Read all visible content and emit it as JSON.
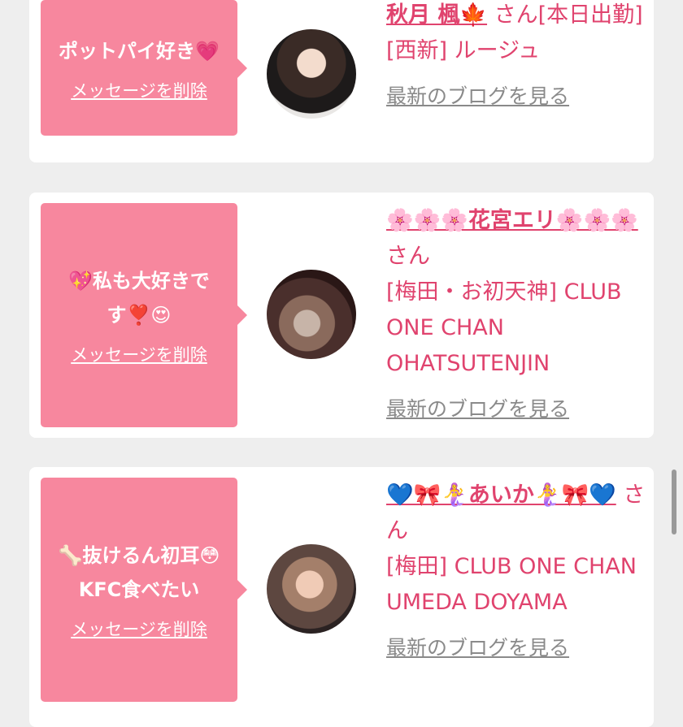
{
  "items": [
    {
      "comment": "ポットパイ好き💗",
      "delete_label": "メッセージを削除",
      "name": "秋月 楓🍁",
      "honorific": "さん[本日出勤]",
      "shop": "[西新] ルージュ",
      "blog_label": "最新のブログを見る"
    },
    {
      "comment": "💖私も大好きです❣️😍",
      "delete_label": "メッセージを削除",
      "name": "🌸🌸🌸花宮エリ🌸🌸🌸",
      "honorific": "さん",
      "shop": "[梅田・お初天神] CLUB ONE CHAN OHATSUTENJIN",
      "blog_label": "最新のブログを見る"
    },
    {
      "comment": "🦴抜けるん初耳😳KFC食べたい",
      "delete_label": "メッセージを削除",
      "name": "💙🎀🧜‍♀️あいか🧜‍♀️🎀💙",
      "honorific": "さん",
      "shop": "[梅田] CLUB ONE CHAN UMEDA DOYAMA",
      "blog_label": "最新のブログを見る"
    }
  ],
  "colors": {
    "accent": "#e0436e",
    "bubble": "#f7879e",
    "muted": "#8a8a8a",
    "background": "#eeeeee"
  }
}
